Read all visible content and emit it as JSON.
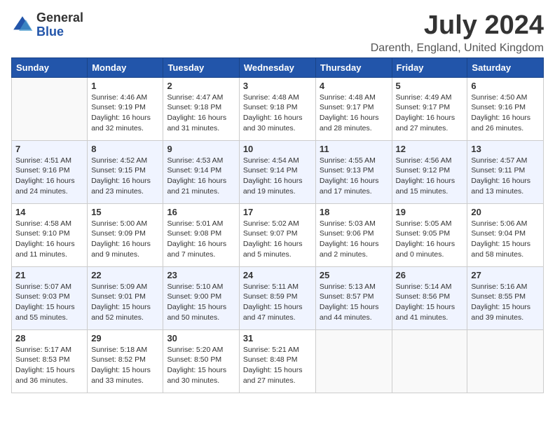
{
  "logo": {
    "general": "General",
    "blue": "Blue"
  },
  "title": "July 2024",
  "location": "Darenth, England, United Kingdom",
  "headers": [
    "Sunday",
    "Monday",
    "Tuesday",
    "Wednesday",
    "Thursday",
    "Friday",
    "Saturday"
  ],
  "weeks": [
    [
      {
        "day": "",
        "info": ""
      },
      {
        "day": "1",
        "info": "Sunrise: 4:46 AM\nSunset: 9:19 PM\nDaylight: 16 hours\nand 32 minutes."
      },
      {
        "day": "2",
        "info": "Sunrise: 4:47 AM\nSunset: 9:18 PM\nDaylight: 16 hours\nand 31 minutes."
      },
      {
        "day": "3",
        "info": "Sunrise: 4:48 AM\nSunset: 9:18 PM\nDaylight: 16 hours\nand 30 minutes."
      },
      {
        "day": "4",
        "info": "Sunrise: 4:48 AM\nSunset: 9:17 PM\nDaylight: 16 hours\nand 28 minutes."
      },
      {
        "day": "5",
        "info": "Sunrise: 4:49 AM\nSunset: 9:17 PM\nDaylight: 16 hours\nand 27 minutes."
      },
      {
        "day": "6",
        "info": "Sunrise: 4:50 AM\nSunset: 9:16 PM\nDaylight: 16 hours\nand 26 minutes."
      }
    ],
    [
      {
        "day": "7",
        "info": "Sunrise: 4:51 AM\nSunset: 9:16 PM\nDaylight: 16 hours\nand 24 minutes."
      },
      {
        "day": "8",
        "info": "Sunrise: 4:52 AM\nSunset: 9:15 PM\nDaylight: 16 hours\nand 23 minutes."
      },
      {
        "day": "9",
        "info": "Sunrise: 4:53 AM\nSunset: 9:14 PM\nDaylight: 16 hours\nand 21 minutes."
      },
      {
        "day": "10",
        "info": "Sunrise: 4:54 AM\nSunset: 9:14 PM\nDaylight: 16 hours\nand 19 minutes."
      },
      {
        "day": "11",
        "info": "Sunrise: 4:55 AM\nSunset: 9:13 PM\nDaylight: 16 hours\nand 17 minutes."
      },
      {
        "day": "12",
        "info": "Sunrise: 4:56 AM\nSunset: 9:12 PM\nDaylight: 16 hours\nand 15 minutes."
      },
      {
        "day": "13",
        "info": "Sunrise: 4:57 AM\nSunset: 9:11 PM\nDaylight: 16 hours\nand 13 minutes."
      }
    ],
    [
      {
        "day": "14",
        "info": "Sunrise: 4:58 AM\nSunset: 9:10 PM\nDaylight: 16 hours\nand 11 minutes."
      },
      {
        "day": "15",
        "info": "Sunrise: 5:00 AM\nSunset: 9:09 PM\nDaylight: 16 hours\nand 9 minutes."
      },
      {
        "day": "16",
        "info": "Sunrise: 5:01 AM\nSunset: 9:08 PM\nDaylight: 16 hours\nand 7 minutes."
      },
      {
        "day": "17",
        "info": "Sunrise: 5:02 AM\nSunset: 9:07 PM\nDaylight: 16 hours\nand 5 minutes."
      },
      {
        "day": "18",
        "info": "Sunrise: 5:03 AM\nSunset: 9:06 PM\nDaylight: 16 hours\nand 2 minutes."
      },
      {
        "day": "19",
        "info": "Sunrise: 5:05 AM\nSunset: 9:05 PM\nDaylight: 16 hours\nand 0 minutes."
      },
      {
        "day": "20",
        "info": "Sunrise: 5:06 AM\nSunset: 9:04 PM\nDaylight: 15 hours\nand 58 minutes."
      }
    ],
    [
      {
        "day": "21",
        "info": "Sunrise: 5:07 AM\nSunset: 9:03 PM\nDaylight: 15 hours\nand 55 minutes."
      },
      {
        "day": "22",
        "info": "Sunrise: 5:09 AM\nSunset: 9:01 PM\nDaylight: 15 hours\nand 52 minutes."
      },
      {
        "day": "23",
        "info": "Sunrise: 5:10 AM\nSunset: 9:00 PM\nDaylight: 15 hours\nand 50 minutes."
      },
      {
        "day": "24",
        "info": "Sunrise: 5:11 AM\nSunset: 8:59 PM\nDaylight: 15 hours\nand 47 minutes."
      },
      {
        "day": "25",
        "info": "Sunrise: 5:13 AM\nSunset: 8:57 PM\nDaylight: 15 hours\nand 44 minutes."
      },
      {
        "day": "26",
        "info": "Sunrise: 5:14 AM\nSunset: 8:56 PM\nDaylight: 15 hours\nand 41 minutes."
      },
      {
        "day": "27",
        "info": "Sunrise: 5:16 AM\nSunset: 8:55 PM\nDaylight: 15 hours\nand 39 minutes."
      }
    ],
    [
      {
        "day": "28",
        "info": "Sunrise: 5:17 AM\nSunset: 8:53 PM\nDaylight: 15 hours\nand 36 minutes."
      },
      {
        "day": "29",
        "info": "Sunrise: 5:18 AM\nSunset: 8:52 PM\nDaylight: 15 hours\nand 33 minutes."
      },
      {
        "day": "30",
        "info": "Sunrise: 5:20 AM\nSunset: 8:50 PM\nDaylight: 15 hours\nand 30 minutes."
      },
      {
        "day": "31",
        "info": "Sunrise: 5:21 AM\nSunset: 8:48 PM\nDaylight: 15 hours\nand 27 minutes."
      },
      {
        "day": "",
        "info": ""
      },
      {
        "day": "",
        "info": ""
      },
      {
        "day": "",
        "info": ""
      }
    ]
  ]
}
